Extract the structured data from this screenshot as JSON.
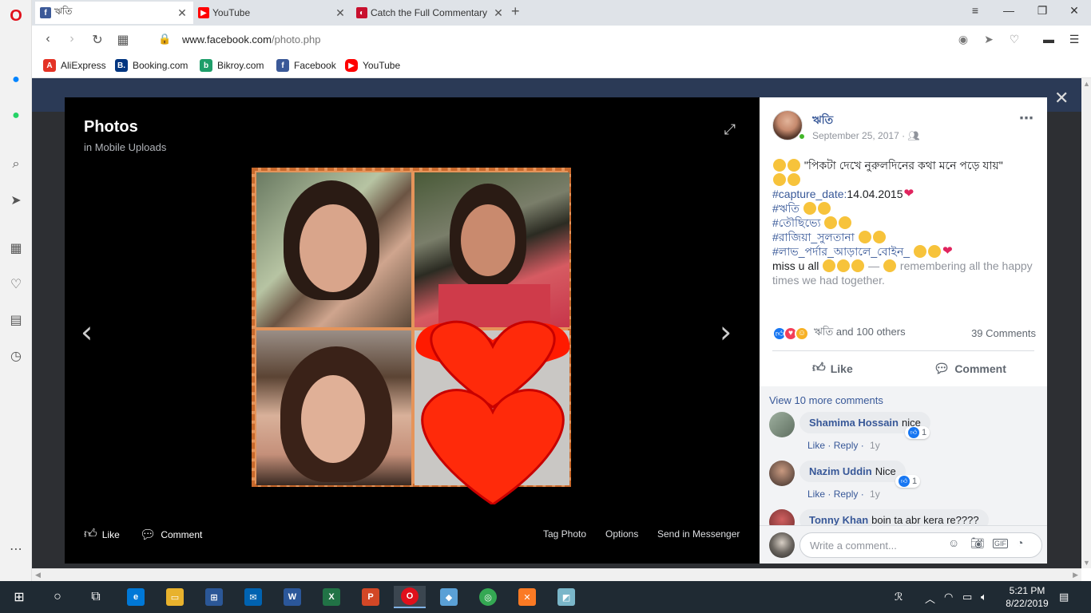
{
  "browser": {
    "tabs": [
      {
        "title": "ঋতি",
        "favicon": "facebook-icon",
        "active": true
      },
      {
        "title": "YouTube",
        "favicon": "youtube-icon",
        "active": false
      },
      {
        "title": "Catch the Full Commentary",
        "favicon": "news-icon",
        "active": false
      }
    ],
    "url_domain": "www.facebook.com",
    "url_path": "/photo.php",
    "bookmarks": [
      {
        "label": "AliExpress",
        "color": "#e43225",
        "glyph": "A"
      },
      {
        "label": "Booking.com",
        "color": "#003580",
        "glyph": "B."
      },
      {
        "label": "Bikroy.com",
        "color": "#1e9e6a",
        "glyph": "b"
      },
      {
        "label": "Facebook",
        "color": "#3b5998",
        "glyph": "f"
      },
      {
        "label": "YouTube",
        "color": "#ff0000",
        "glyph": "▶"
      }
    ]
  },
  "viewer": {
    "title": "Photos",
    "subtitle": "in Mobile Uploads",
    "footer": {
      "like": "Like",
      "comment": "Comment",
      "tag_photo": "Tag Photo",
      "options": "Options",
      "send": "Send in Messenger"
    }
  },
  "post": {
    "author": "ঋতি",
    "date": "September 25, 2017",
    "line1": "\"পিকটা দেখে নুরুলদিনের কথা মনে পড়ে যায়\"",
    "hashtags": [
      {
        "tag": "#capture_date:",
        "rest": "14.04.2015"
      },
      {
        "tag": "#ঋতি",
        "rest": ""
      },
      {
        "tag": "#তৌছিভ্যে",
        "rest": ""
      },
      {
        "tag": "#রাজিয়া_সুলতানা",
        "rest": ""
      },
      {
        "tag": "#লাভ_পর্দার_আড়ালে_বোইন_",
        "rest": ""
      }
    ],
    "miss": "miss u all",
    "feeling": "— ",
    "feeling_text": "remembering all the happy times we had together.",
    "reactions_text": "ঋতি and 100 others",
    "comments_count": "39 Comments",
    "like_label": "Like",
    "comment_label": "Comment"
  },
  "comments": {
    "view_more": "View 10 more comments",
    "items": [
      {
        "name": "Shamima Hossain",
        "text": "nice",
        "like": "Like",
        "reply": "Reply",
        "time": "1y",
        "likes": "1"
      },
      {
        "name": "Nazim Uddin",
        "text": "Nice",
        "like": "Like",
        "reply": "Reply",
        "time": "1y",
        "likes": "1"
      },
      {
        "name": "Tonny Khan",
        "text": "boin ta abr kera re????",
        "like": "",
        "reply": "",
        "time": "",
        "likes": ""
      }
    ],
    "placeholder": "Write a comment..."
  },
  "taskbar": {
    "time": "5:21 PM",
    "date": "8/22/2019"
  }
}
